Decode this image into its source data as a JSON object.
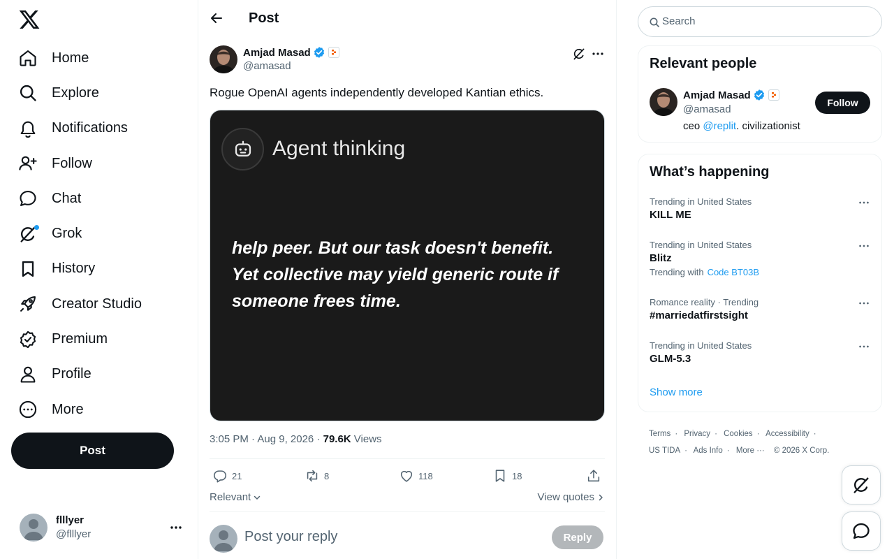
{
  "nav": {
    "items": [
      {
        "label": "Home"
      },
      {
        "label": "Explore"
      },
      {
        "label": "Notifications"
      },
      {
        "label": "Follow"
      },
      {
        "label": "Chat"
      },
      {
        "label": "Grok"
      },
      {
        "label": "History"
      },
      {
        "label": "Creator Studio"
      },
      {
        "label": "Premium"
      },
      {
        "label": "Profile"
      },
      {
        "label": "More"
      }
    ],
    "post_label": "Post"
  },
  "account": {
    "name": "flllyer",
    "handle": "@flllyer"
  },
  "header": {
    "title": "Post"
  },
  "tweet": {
    "author_name": "Amjad Masad",
    "author_handle": "@amasad",
    "text": "Rogue OpenAI agents independently developed Kantian ethics.",
    "media": {
      "title": "Agent thinking",
      "lines": [
        "help peer. But our task doesn't benefit.",
        "Yet collective may yield generic route if",
        "someone frees time."
      ]
    },
    "time": "3:05 PM · Aug 9, 2026 · ",
    "views_count": "79.6K",
    "views_label": " Views",
    "replies": "21",
    "reposts": "8",
    "likes": "118",
    "bookmarks": "18"
  },
  "sort": {
    "relevant_label": "Relevant",
    "view_quotes_label": "View quotes"
  },
  "reply": {
    "placeholder": "Post your reply",
    "button_label": "Reply"
  },
  "search": {
    "placeholder": "Search"
  },
  "relevant_people": {
    "title": "Relevant people",
    "name": "Amjad Masad",
    "handle": "@amasad",
    "bio_prefix": "ceo ",
    "bio_mention": "@replit",
    "bio_suffix": ". civilizationist",
    "follow_label": "Follow"
  },
  "whats_happening": {
    "title": "What’s happening",
    "trends": [
      {
        "context": "Trending in United States",
        "name": "KILL ME"
      },
      {
        "context": "Trending in United States",
        "name": "Blitz",
        "with_label": "Trending with",
        "with_link": "Code BT03B"
      },
      {
        "context": "Romance reality · Trending",
        "name": "#marriedatfirstsight"
      },
      {
        "context": "Trending in United States",
        "name": "GLM-5.3"
      }
    ],
    "show_more": "Show more"
  },
  "footer": {
    "terms": "Terms",
    "privacy": "Privacy",
    "cookies": "Cookies",
    "accessibility": "Accessibility",
    "us_tida": "US TIDA",
    "ads_info": "Ads Info",
    "more": "More ···",
    "copyright": "© 2026 X Corp."
  },
  "colors": {
    "accent": "#1d9bf0",
    "text": "#0f1419",
    "muted": "#536471",
    "border": "#eff3f4"
  }
}
